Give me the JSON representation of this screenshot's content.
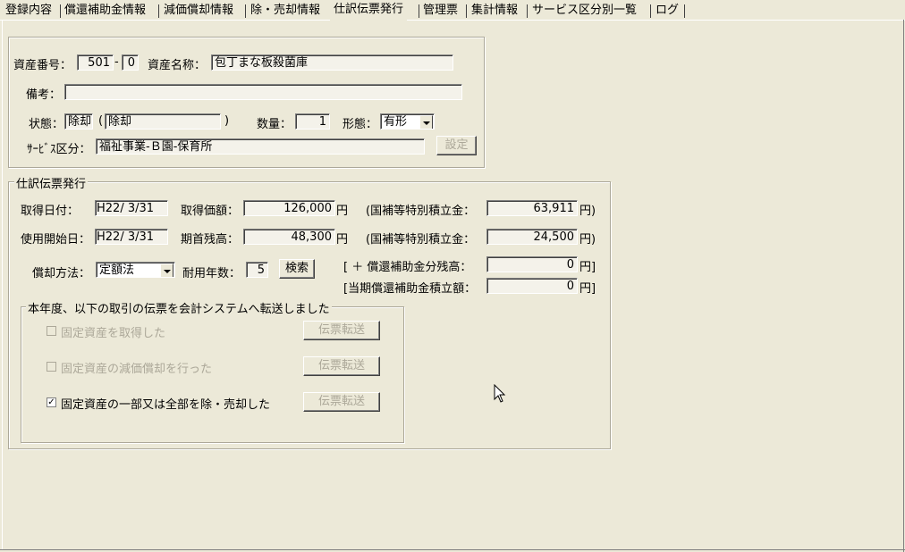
{
  "tabs": [
    {
      "label": "登録内容"
    },
    {
      "label": "償還補助金情報"
    },
    {
      "label": "減価償却情報"
    },
    {
      "label": "除・売却情報"
    },
    {
      "label": "仕訳伝票発行"
    },
    {
      "label": "管理票"
    },
    {
      "label": "集計情報"
    },
    {
      "label": "サービス区分別一覧"
    },
    {
      "label": "ログ"
    }
  ],
  "asset": {
    "number_label": "資産番号：",
    "number_main": "501",
    "number_dash": "-",
    "number_sub": "0",
    "name_label": "資産名称：",
    "name_value": "包丁まな板殺菌庫",
    "remarks_label": "備考：",
    "remarks_value": "",
    "status_label": "状態：",
    "status_code": "除却",
    "status_open": "(",
    "status_text": "除却",
    "status_close": ")",
    "qty_label": "数量：",
    "qty_value": "1",
    "form_label": "形態：",
    "form_value": "有形",
    "service_label": "ｻｰﾋﾞｽ区分：",
    "service_value": "福祉事業-Ｂ園-保育所",
    "settings_button": "設定"
  },
  "journal": {
    "group_title": "仕訳伝票発行",
    "acq_date_label": "取得日付：",
    "acq_date_value": "H22/ 3/31",
    "acq_price_label": "取得価額：",
    "acq_price_value": "126,000",
    "yen": "円",
    "subsidy_label_1": "(国補等特別積立金：",
    "subsidy_value_1": "63,911",
    "yen_paren": "円)",
    "start_date_label": "使用開始日：",
    "start_date_value": "H22/ 3/31",
    "opening_label": "期首残高：",
    "opening_value": "48,300",
    "subsidy_label_2": "(国補等特別積立金：",
    "subsidy_value_2": "24,500",
    "method_label": "償却方法：",
    "method_value": "定額法",
    "life_label": "耐用年数：",
    "life_value": "5",
    "search_button": "検索",
    "repay_label": "[ ＋ 償還補助金分残高：",
    "repay_value": "0",
    "yen_bracket": "円]",
    "current_label": "[当期償還補助金積立額：",
    "current_value": "0"
  },
  "transfer": {
    "group_title": "本年度、以下の取引の伝票を会計システムへ転送しました",
    "items": [
      {
        "label": "固定資産を取得した",
        "checked": false,
        "enabled": false,
        "button": "伝票転送"
      },
      {
        "label": "固定資産の減価償却を行った",
        "checked": false,
        "enabled": false,
        "button": "伝票転送"
      },
      {
        "label": "固定資産の一部又は全部を除・売却した",
        "checked": true,
        "enabled": true,
        "button": "伝票転送"
      }
    ],
    "check_mark": "✓"
  }
}
